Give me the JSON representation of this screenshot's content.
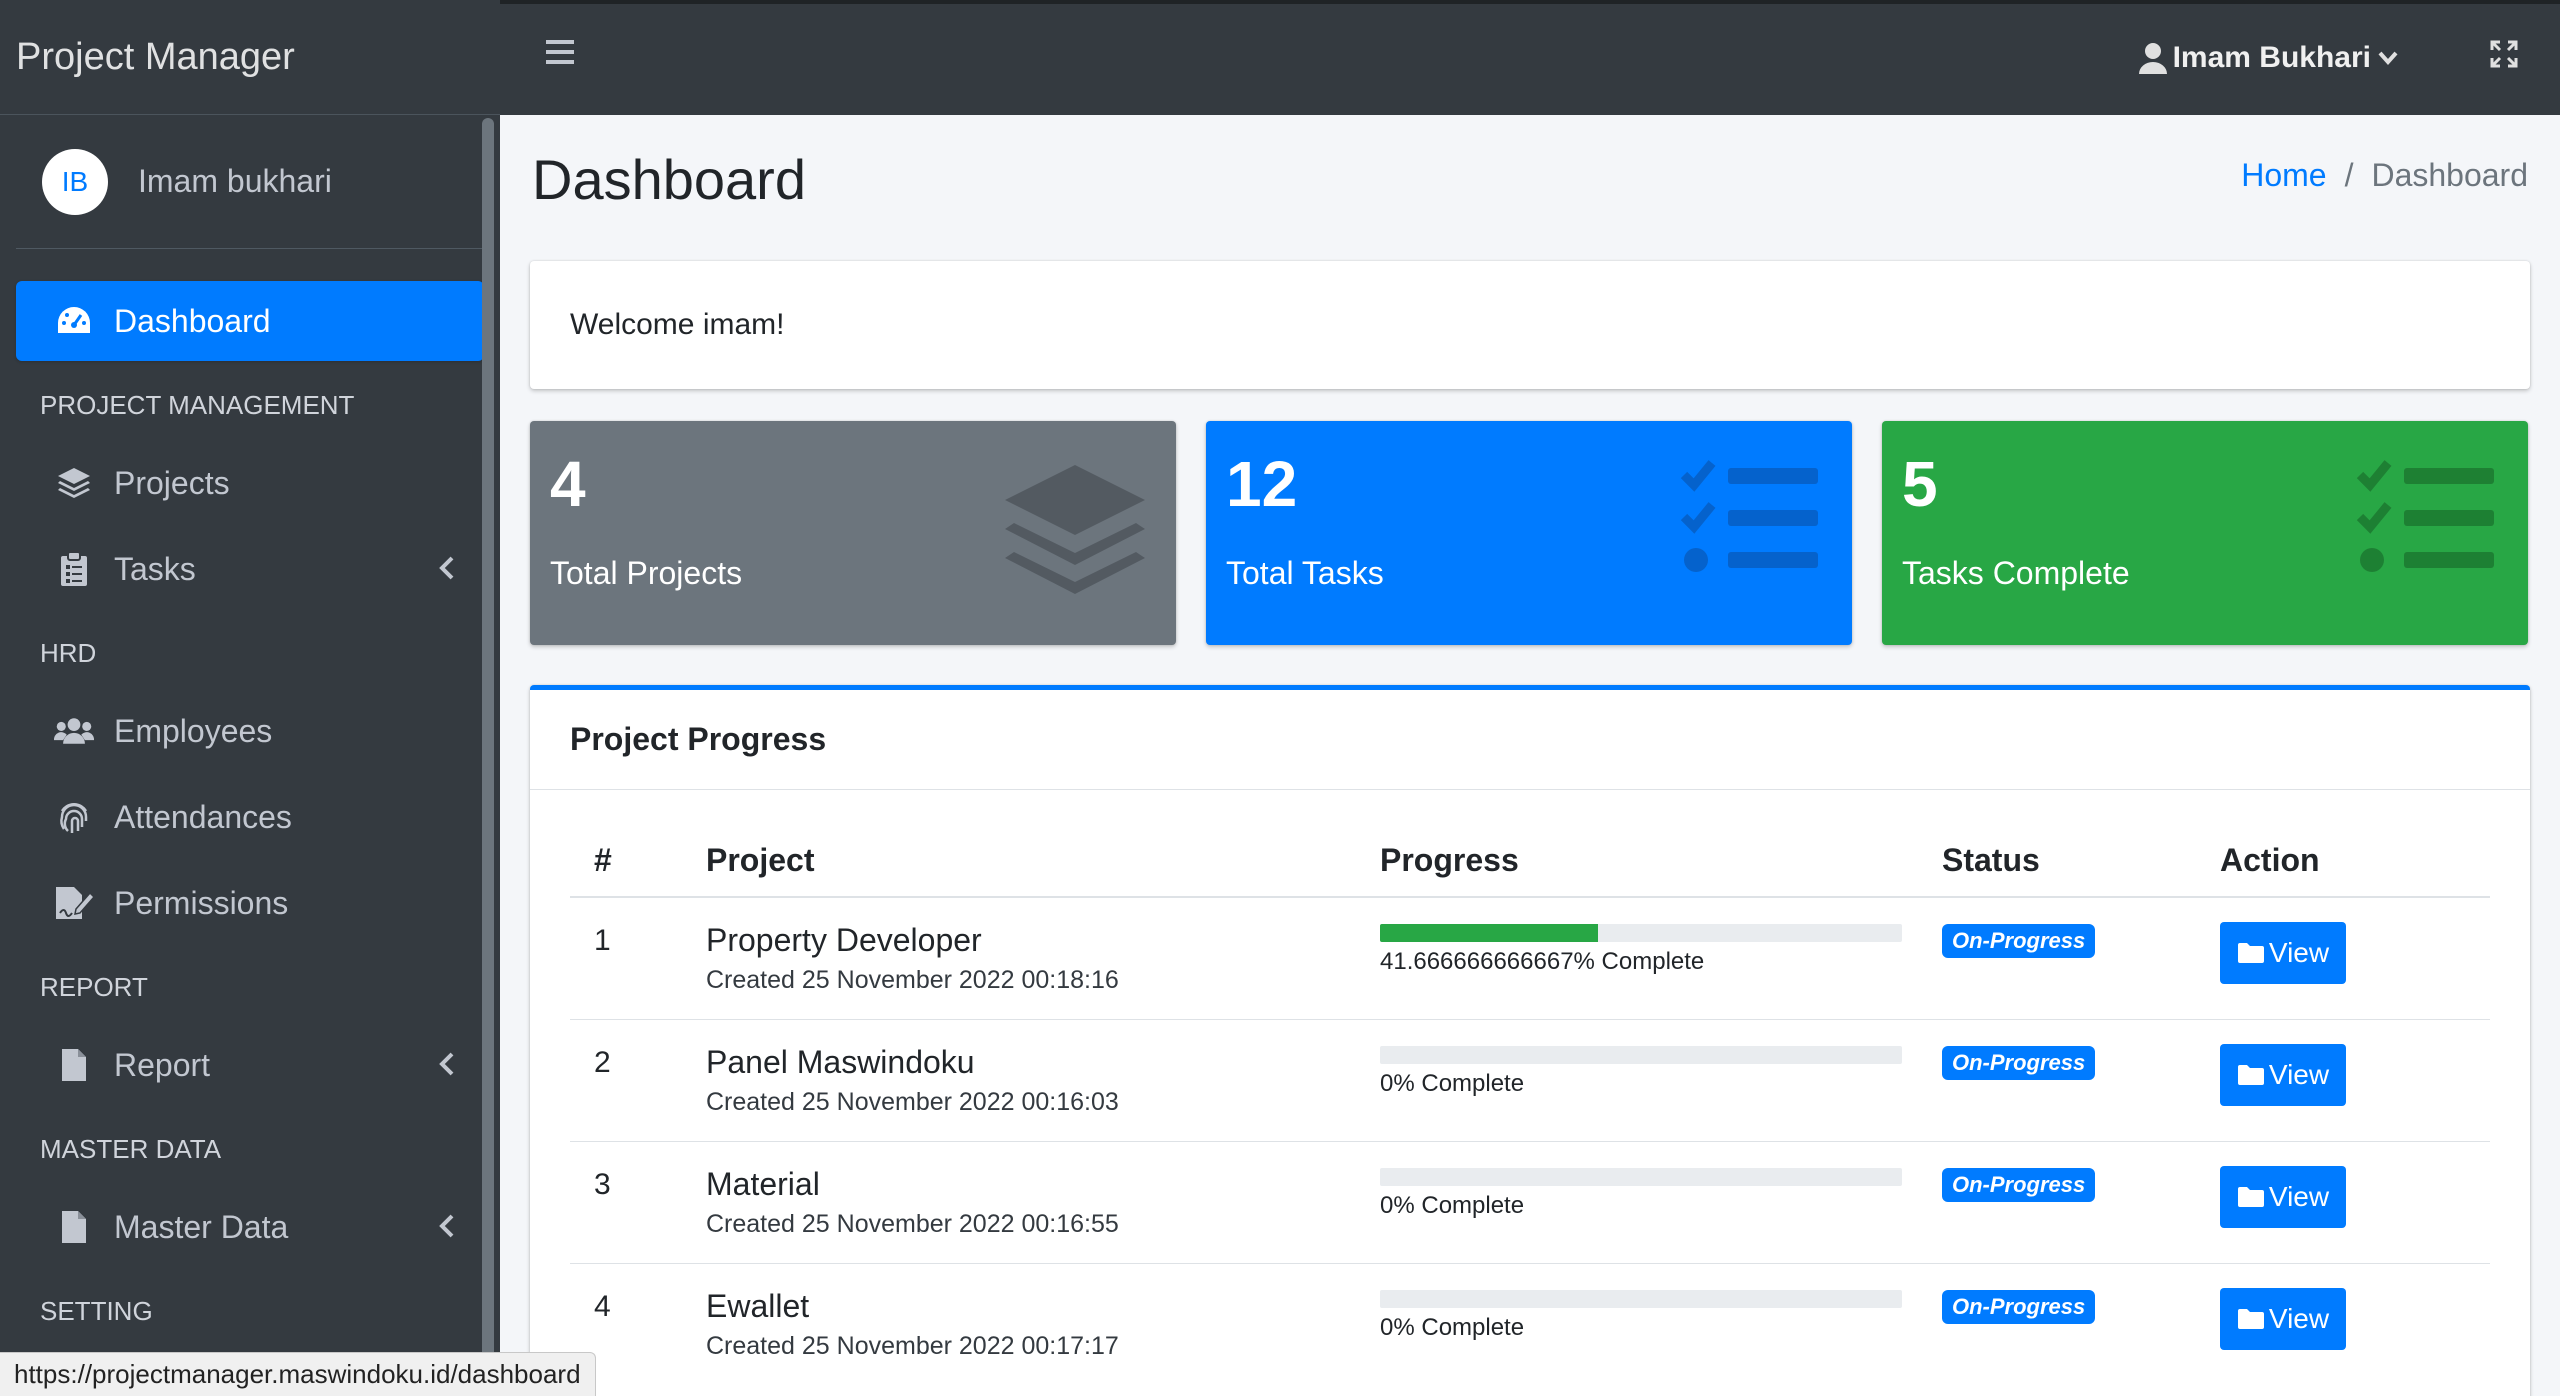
{
  "brand": {
    "title": "Project Manager"
  },
  "user": {
    "initials": "IB",
    "name": "Imam bukhari",
    "navbar_name": "Imam Bukhari"
  },
  "sidebar": {
    "dashboard": "Dashboard",
    "sections": {
      "project_management": "PROJECT MANAGEMENT",
      "hrd": "HRD",
      "report": "REPORT",
      "master_data": "MASTER DATA",
      "setting": "SETTING"
    },
    "items": {
      "projects": "Projects",
      "tasks": "Tasks",
      "employees": "Employees",
      "attendances": "Attendances",
      "permissions": "Permissions",
      "report": "Report",
      "master_data": "Master Data"
    }
  },
  "page": {
    "title": "Dashboard",
    "breadcrumb": {
      "home": "Home",
      "separator": "/",
      "current": "Dashboard"
    },
    "welcome": "Welcome imam!"
  },
  "stats": [
    {
      "value": "4",
      "label": "Total Projects",
      "color": "#6c757d",
      "icon": "layer-group-icon"
    },
    {
      "value": "12",
      "label": "Total Tasks",
      "color": "#007bff",
      "icon": "tasks-icon"
    },
    {
      "value": "5",
      "label": "Tasks Complete",
      "color": "#28a745",
      "icon": "tasks-icon"
    }
  ],
  "progress_card": {
    "title": "Project Progress",
    "columns": {
      "no": "#",
      "project": "Project",
      "progress": "Progress",
      "status": "Status",
      "action": "Action"
    },
    "rows": [
      {
        "no": "1",
        "name": "Property Developer",
        "created": "Created 25 November 2022 00:18:16",
        "progress": 41.666666666667,
        "progress_text": "41.666666666667% Complete",
        "status": "On-Progress",
        "action": "View"
      },
      {
        "no": "2",
        "name": "Panel Maswindoku",
        "created": "Created 25 November 2022 00:16:03",
        "progress": 0,
        "progress_text": "0% Complete",
        "status": "On-Progress",
        "action": "View"
      },
      {
        "no": "3",
        "name": "Material",
        "created": "Created 25 November 2022 00:16:55",
        "progress": 0,
        "progress_text": "0% Complete",
        "status": "On-Progress",
        "action": "View"
      },
      {
        "no": "4",
        "name": "Ewallet",
        "created": "Created 25 November 2022 00:17:17",
        "progress": 0,
        "progress_text": "0% Complete",
        "status": "On-Progress",
        "action": "View"
      }
    ]
  },
  "statusbar": {
    "url": "https://projectmanager.maswindoku.id/dashboard"
  },
  "colors": {
    "primary": "#007bff",
    "success": "#28a745",
    "secondary": "#6c757d",
    "sidebar": "#343a40"
  }
}
